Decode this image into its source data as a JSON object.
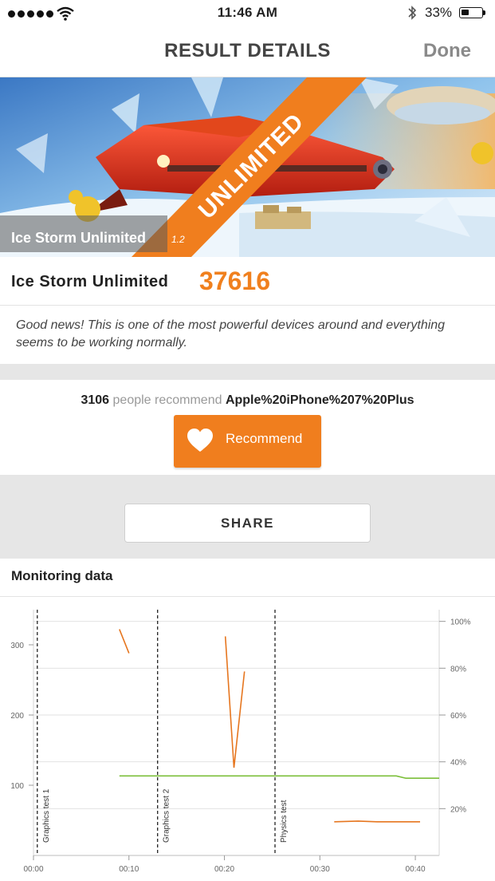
{
  "status_bar": {
    "time": "11:46 AM",
    "battery": "33%",
    "signal_dots": 5
  },
  "nav": {
    "title": "RESULT DETAILS",
    "done": "Done"
  },
  "hero": {
    "banner": "UNLIMITED",
    "caption": "Ice Storm Unlimited",
    "version": "1.2"
  },
  "score": {
    "name": "Ice Storm Unlimited",
    "value": "37616",
    "message": "Good news! This is one of the most powerful devices around and everything seems to be working normally."
  },
  "recommend": {
    "count": "3106",
    "text": "people recommend",
    "device": "Apple%20iPhone%207%20Plus",
    "button": "Recommend"
  },
  "share": {
    "label": "SHARE"
  },
  "monitoring": {
    "title": "Monitoring data"
  },
  "colors": {
    "accent": "#f07e1e",
    "orange_line": "#e6761f",
    "green_line": "#7cbf3a"
  },
  "chart_data": {
    "type": "line",
    "x_ticks": [
      "00:00",
      "00:10",
      "00:20",
      "00:30",
      "00:40"
    ],
    "y_left_ticks": [
      "100",
      "200",
      "300"
    ],
    "y_right_ticks": [
      "20%",
      "40%",
      "60%",
      "80%",
      "100%"
    ],
    "ylim_left": [
      0,
      350
    ],
    "ylim_right": [
      0,
      105
    ],
    "grid": true,
    "markers": [
      {
        "label": "Graphics test 1",
        "x": 0.4
      },
      {
        "label": "Graphics test 2",
        "x": 13.0
      },
      {
        "label": "Physics test",
        "x": 25.3
      }
    ],
    "series": [
      {
        "axis": "left",
        "color": "#e6761f",
        "segments": [
          [
            [
              9.0,
              322
            ],
            [
              10.0,
              288
            ]
          ],
          [
            [
              20.1,
              312
            ],
            [
              21.0,
              125
            ],
            [
              22.1,
              262
            ]
          ],
          [
            [
              31.5,
              48
            ],
            [
              34.0,
              49
            ],
            [
              36.0,
              48
            ],
            [
              40.5,
              48
            ]
          ]
        ]
      },
      {
        "axis": "right",
        "color": "#7cbf3a",
        "segments": [
          [
            [
              9.0,
              34
            ],
            [
              38.0,
              34
            ],
            [
              39.0,
              33
            ],
            [
              42.5,
              33
            ]
          ]
        ]
      }
    ]
  }
}
